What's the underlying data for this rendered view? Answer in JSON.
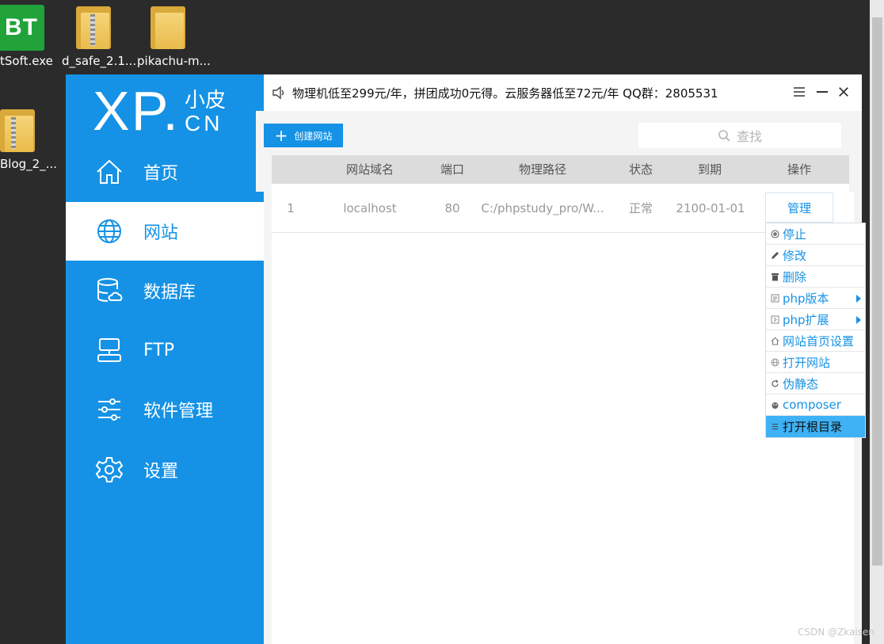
{
  "desktop": {
    "icons": [
      {
        "label": "tSoft.exe",
        "tile_text": "BT"
      },
      {
        "label": "d_safe_2.1..."
      },
      {
        "label": "pikachu-m..."
      },
      {
        "label": "Blog_2_..."
      }
    ]
  },
  "logo": {
    "brand": "XP.",
    "cn_small": "小皮",
    "domain": "CN"
  },
  "sidebar": {
    "items": [
      {
        "label": "首页",
        "icon": "home-icon"
      },
      {
        "label": "网站",
        "icon": "globe-icon",
        "active": true
      },
      {
        "label": "数据库",
        "icon": "database-icon"
      },
      {
        "label": "FTP",
        "icon": "ftp-icon"
      },
      {
        "label": "软件管理",
        "icon": "sliders-icon"
      },
      {
        "label": "设置",
        "icon": "gear-icon"
      }
    ]
  },
  "topbar": {
    "notice": "物理机低至299元/年，拼团成功0元得。云服务器低至72元/年 QQ群：2805531"
  },
  "toolbar": {
    "create_label": "创建网站",
    "search_placeholder": "查找"
  },
  "table": {
    "headers": [
      "网站域名",
      "端口",
      "物理路径",
      "状态",
      "到期",
      "操作"
    ],
    "rows": [
      {
        "index": "1",
        "domain": "localhost",
        "port": "80",
        "path": "C:/phpstudy_pro/W...",
        "status": "正常",
        "expire": "2100-01-01",
        "action": "管理"
      }
    ]
  },
  "menu": {
    "items": [
      {
        "label": "停止",
        "icon": "stop-icon"
      },
      {
        "label": "修改",
        "icon": "pencil-icon"
      },
      {
        "label": "删除",
        "icon": "trash-icon"
      },
      {
        "label": "php版本",
        "icon": "php-icon",
        "submenu": true
      },
      {
        "label": "php扩展",
        "icon": "extension-icon",
        "submenu": true
      },
      {
        "label": "网站首页设置",
        "icon": "home-small-icon"
      },
      {
        "label": "打开网站",
        "icon": "globe-small-icon"
      },
      {
        "label": "伪静态",
        "icon": "refresh-icon"
      },
      {
        "label": "composer",
        "icon": "composer-icon"
      },
      {
        "label": "打开根目录",
        "icon": "list-icon",
        "highlighted": true
      }
    ]
  },
  "watermark": "CSDN @Zkaisen",
  "colors": {
    "primary": "#1592e6",
    "highlight": "#3fb1f5",
    "desktop": "#2b2b2b"
  }
}
